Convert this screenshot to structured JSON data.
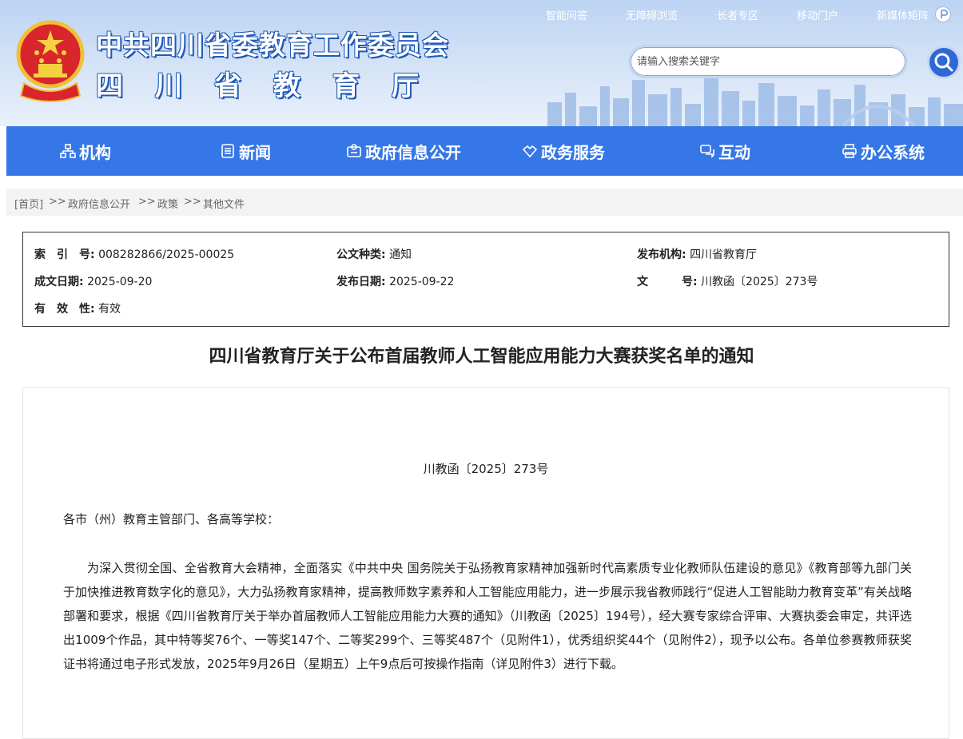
{
  "header": {
    "org_name": "中共四川省委教育工作委员会",
    "dept_name": "四川省教育厅",
    "top_links": [
      "智能问答",
      "无障碍浏览",
      "长者专区",
      "移动门户",
      "新媒体矩阵"
    ],
    "search_placeholder": "请输入搜索关键字",
    "colors": {
      "primary": "#3577e6",
      "title_outline": "#1f58b8",
      "header_bg": "#c8dbf5"
    }
  },
  "nav": {
    "items": [
      {
        "label": "机构",
        "icon": "org-chart-icon"
      },
      {
        "label": "新闻",
        "icon": "newspaper-icon"
      },
      {
        "label": "政府信息公开",
        "icon": "info-card-icon"
      },
      {
        "label": "政务服务",
        "icon": "handshake-icon"
      },
      {
        "label": "互动",
        "icon": "chat-icon"
      },
      {
        "label": "办公系统",
        "icon": "printer-icon"
      }
    ]
  },
  "breadcrumb": {
    "items": [
      "[首页]",
      "政府信息公开",
      "政策",
      "其他文件"
    ],
    "separator": ">>"
  },
  "meta": {
    "index_label": "索　引　号:",
    "index_value": "008282866/2025-00025",
    "type_label": "公文种类:",
    "type_value": "通知",
    "issuer_label": "发布机构:",
    "issuer_value": "四川省教育厅",
    "made_label": "成文日期:",
    "made_value": "2025-09-20",
    "pub_label": "发布日期:",
    "pub_value": "2025-09-22",
    "docno_label": "文　　　号:",
    "docno_value": "川教函〔2025〕273号",
    "valid_label": "有　效　性:",
    "valid_value": "有效"
  },
  "article": {
    "title": "四川省教育厅关于公布首届教师人工智能应用能力大赛获奖名单的通知",
    "doc_number": "川教函〔2025〕273号",
    "salutation": "各市（州）教育主管部门、各高等学校：",
    "paragraph": "为深入贯彻全国、全省教育大会精神，全面落实《中共中央 国务院关于弘扬教育家精神加强新时代高素质专业化教师队伍建设的意见》《教育部等九部门关于加快推进教育数字化的意见》，大力弘扬教育家精神，提高教师数字素养和人工智能应用能力，进一步展示我省教师践行“促进人工智能助力教育变革”有关战略部署和要求，根据《四川省教育厅关于举办首届教师人工智能应用能力大赛的通知》（川教函〔2025〕194号），经大赛专家综合评审、大赛执委会审定，共评选出1009个作品，其中特等奖76个、一等奖147个、二等奖299个、三等奖487个（见附件1），优秀组织奖44个（见附件2），现予以公布。各单位参赛教师获奖证书将通过电子形式发放，2025年9月26日（星期五）上午9点后可按操作指南（详见附件3）进行下载。"
  }
}
